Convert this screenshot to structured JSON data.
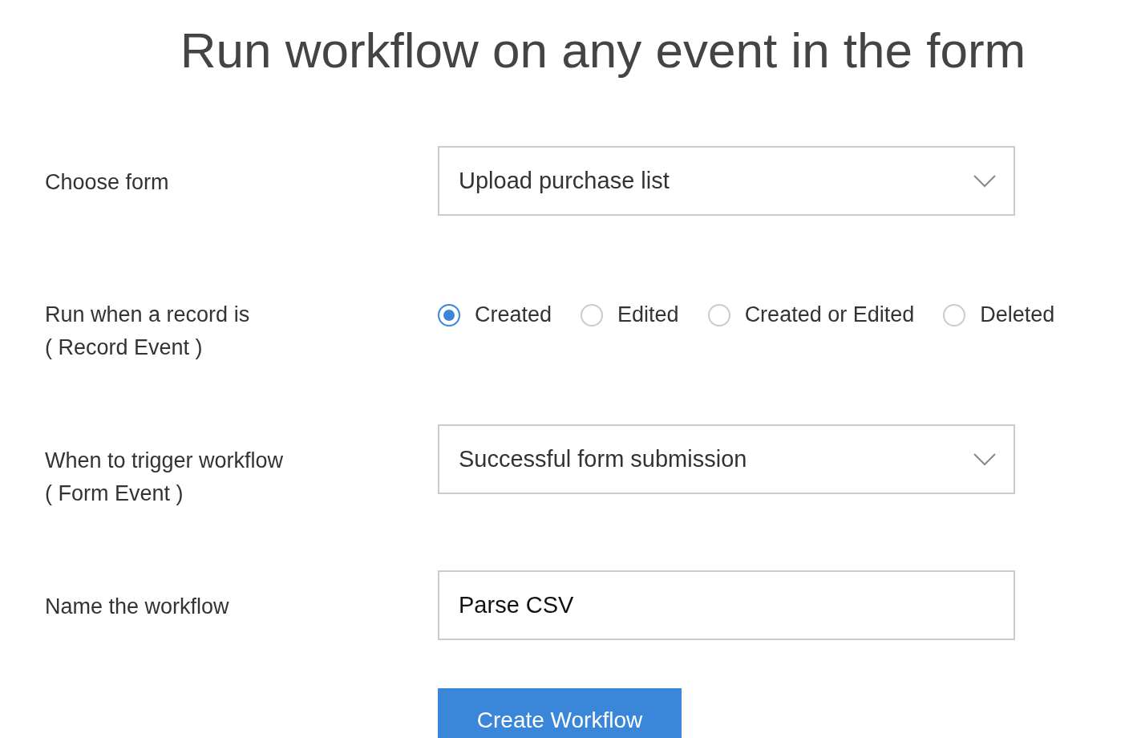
{
  "title": "Run workflow on any event in the form",
  "rows": [
    {
      "kind": "select",
      "label": "Choose form",
      "value": "Upload purchase list"
    },
    {
      "kind": "radio",
      "label": "Run when a record is",
      "sublabel": "( Record Event )",
      "options": [
        {
          "label": "Created",
          "selected": true
        },
        {
          "label": "Edited",
          "selected": false
        },
        {
          "label": "Created or Edited",
          "selected": false
        },
        {
          "label": "Deleted",
          "selected": false
        }
      ]
    },
    {
      "kind": "select",
      "label": "When to trigger workflow",
      "sublabel": "( Form Event )",
      "value": "Successful form submission"
    },
    {
      "kind": "text",
      "label": "Name the workflow",
      "value": "Parse CSV"
    }
  ],
  "button": "Create Workflow"
}
